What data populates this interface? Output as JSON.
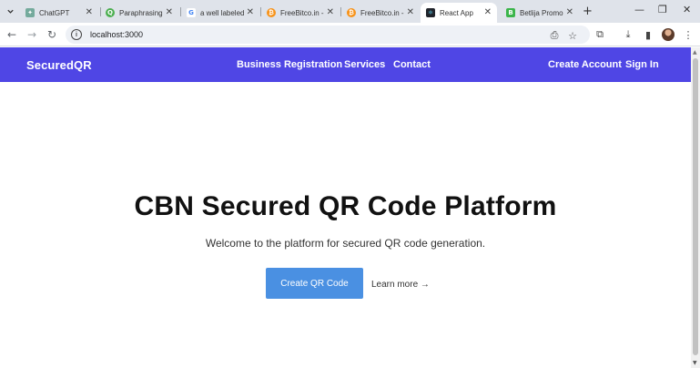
{
  "browser": {
    "tabs": [
      {
        "title": "ChatGPT",
        "icon": "chatgpt-icon",
        "color": "#74aa9c",
        "glyph": "✦"
      },
      {
        "title": "Paraphrasing",
        "icon": "quillbot-icon",
        "color": "#4caf50",
        "glyph": "Q"
      },
      {
        "title": "a well labeled",
        "icon": "google-icon",
        "color": "#ffffff",
        "glyph": "G"
      },
      {
        "title": "FreeBitco.in -",
        "icon": "bitcoin-icon",
        "color": "#f7931a",
        "glyph": "₿"
      },
      {
        "title": "FreeBitco.in -",
        "icon": "bitcoin-icon",
        "color": "#f7931a",
        "glyph": "₿"
      },
      {
        "title": "React App",
        "icon": "react-icon",
        "color": "#20232a",
        "glyph": "⚛",
        "active": true
      },
      {
        "title": "Betlija Promo",
        "icon": "betika-icon",
        "color": "#3bb54a",
        "glyph": "B"
      }
    ],
    "url": "localhost:3000"
  },
  "navbar": {
    "brand": "SecuredQR",
    "links": [
      "Business Registration",
      "Services",
      "Contact"
    ],
    "create_account": "Create Account",
    "sign_in": "Sign In",
    "color": "#4f46e5"
  },
  "hero": {
    "title": "CBN Secured QR Code Platform",
    "subtitle": "Welcome to the platform for secured QR code generation.",
    "cta_label": "Create QR Code",
    "learn_more": "Learn more →",
    "cta_color": "#4a90e2"
  }
}
